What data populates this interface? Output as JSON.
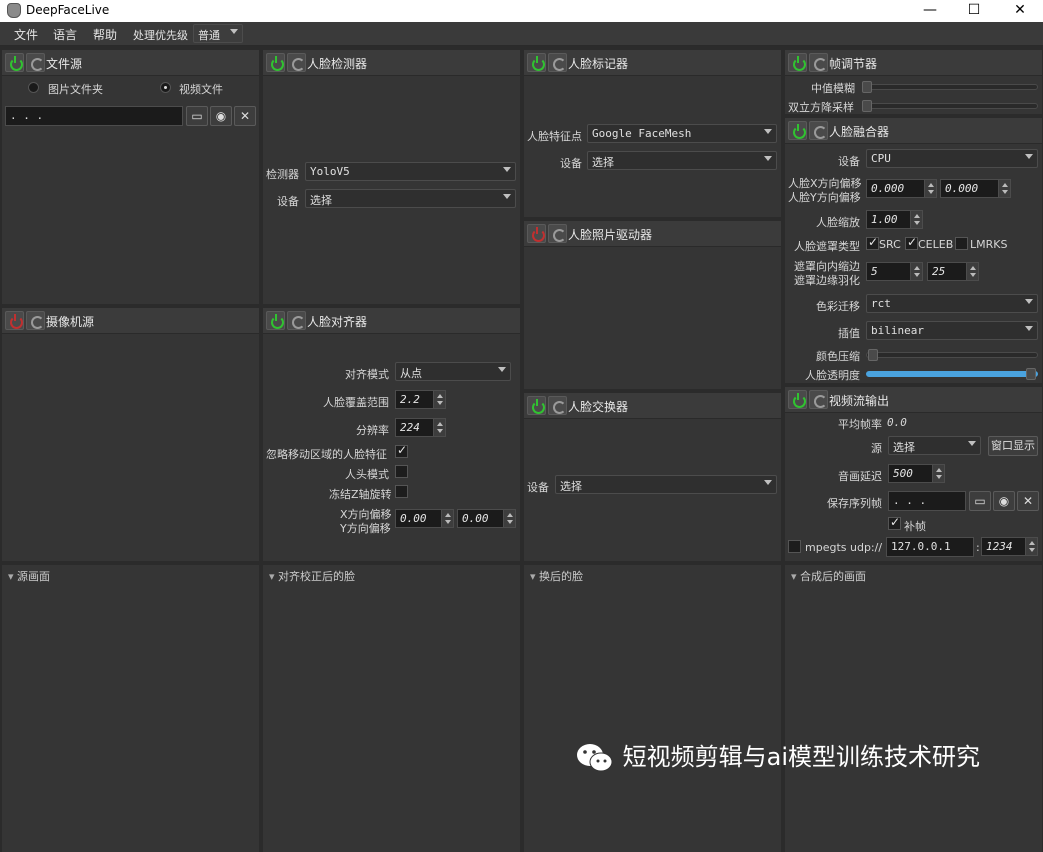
{
  "window": {
    "title": "DeepFaceLive",
    "min": "—",
    "max": "☐",
    "close": "✕"
  },
  "menu": {
    "file": "文件",
    "language": "语言",
    "help": "帮助",
    "priority_label": "处理优先级",
    "priority_value": "普通"
  },
  "file_source": {
    "title": "文件源",
    "image_folder": "图片文件夹",
    "video_file": "视频文件",
    "path": ". . ."
  },
  "camera_source": {
    "title": "摄像机源"
  },
  "face_detector": {
    "title": "人脸检测器",
    "detector_label": "检测器",
    "detector_value": "YoloV5",
    "device_label": "设备",
    "device_value": "选择"
  },
  "face_aligner": {
    "title": "人脸对齐器",
    "align_mode_label": "对齐模式",
    "align_mode_value": "从点",
    "face_coverage_label": "人脸覆盖范围",
    "face_coverage_value": "2.2",
    "resolution_label": "分辨率",
    "resolution_value": "224",
    "exclude_moving_label": "忽略移动区域的人脸特征",
    "head_mode_label": "人头模式",
    "freeze_z_label": "冻结Z轴旋转",
    "x_offset_label": "X方向偏移",
    "y_offset_label": "Y方向偏移",
    "x_offset_value": "0.00",
    "y_offset_value": "0.00"
  },
  "face_marker": {
    "title": "人脸标记器",
    "landmarks_label": "人脸特征点",
    "landmarks_value": "Google FaceMesh",
    "device_label": "设备",
    "device_value": "选择"
  },
  "face_animator": {
    "title": "人脸照片驱动器"
  },
  "face_swapper": {
    "title": "人脸交换器",
    "device_label": "设备",
    "device_value": "选择"
  },
  "frame_adjuster": {
    "title": "帧调节器",
    "median_blur_label": "中值模糊",
    "bilateral_label": "双立方降采样"
  },
  "face_merger": {
    "title": "人脸融合器",
    "device_label": "设备",
    "device_value": "CPU",
    "x_offset_label": "人脸X方向偏移",
    "y_offset_label": "人脸Y方向偏移",
    "x_offset_value": "0.000",
    "y_offset_value": "0.000",
    "scale_label": "人脸缩放",
    "scale_value": "1.00",
    "mask_type_label": "人脸遮罩类型",
    "mask_src": "SRC",
    "mask_celeb": "CELEB",
    "mask_lmrks": "LMRKS",
    "erode_label": "遮罩向内缩边",
    "blur_label": "遮罩边缘羽化",
    "erode_value": "5",
    "blur_value": "25",
    "color_transfer_label": "色彩迁移",
    "color_transfer_value": "rct",
    "interpolation_label": "插值",
    "interpolation_value": "bilinear",
    "color_compression_label": "颜色压缩",
    "opacity_label": "人脸透明度"
  },
  "stream_output": {
    "title": "视频流输出",
    "avg_fps_label": "平均帧率",
    "avg_fps_value": "0.0",
    "source_label": "源",
    "source_value": "选择",
    "window_button": "窗口显示",
    "delay_label": "音画延迟",
    "delay_value": "500",
    "save_seq_label": "保存序列帧",
    "save_seq_path": ". . .",
    "fill_frames_label": "补帧",
    "mpegts_label": "mpegts udp://",
    "host": "127.0.0.1",
    "port_sep": ":",
    "port": "1234"
  },
  "viewers": {
    "source": "源画面",
    "aligned": "对齐校正后的脸",
    "swapped": "换后的脸",
    "merged": "合成后的画面"
  },
  "watermark": "短视频剪辑与ai模型训练技术研究",
  "colors": {
    "accent_on": "#31c231",
    "accent_off": "#c03030",
    "panel_bg": "#353535",
    "slider_fill": "#4aa3df"
  }
}
